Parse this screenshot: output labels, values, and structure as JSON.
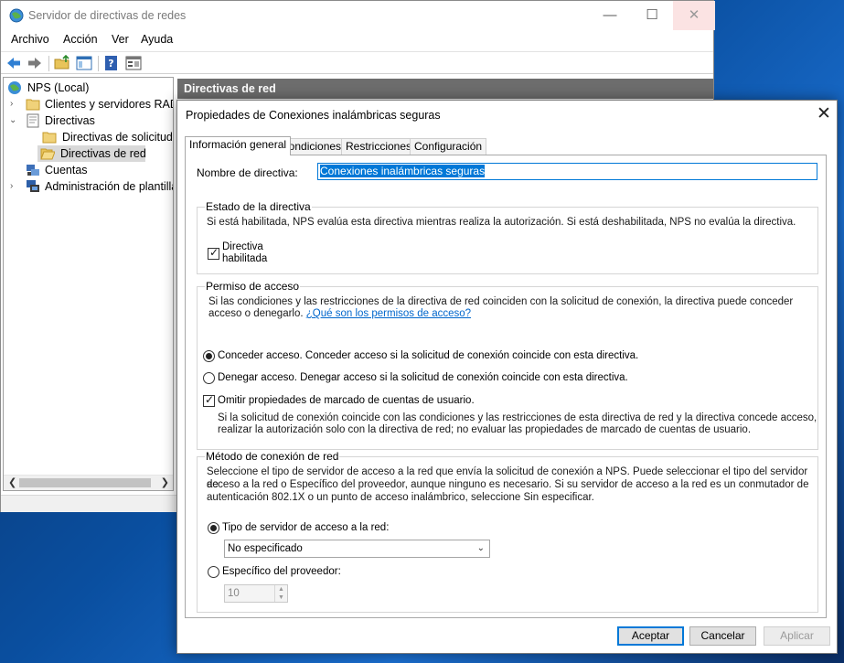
{
  "main_window": {
    "title": "Servidor de directivas de redes",
    "controls": {
      "minimize": "—",
      "maximize": "☐",
      "close": "✕"
    },
    "menu": [
      "Archivo",
      "Acción",
      "Ver",
      "Ayuda"
    ],
    "toolbar_icons": [
      "back-arrow-icon",
      "forward-arrow-icon",
      "folder-up-icon",
      "show-hide-tree-icon",
      "help-icon",
      "properties-icon"
    ]
  },
  "tree": {
    "items": [
      {
        "label": "NPS (Local)",
        "icon": "nps-globe-icon"
      },
      {
        "label": "Clientes y servidores RADIUS",
        "icon": "folder-icon"
      },
      {
        "label": "Directivas",
        "icon": "policies-icon"
      },
      {
        "label": "Directivas de solicitud de conexión",
        "icon": "folder-icon"
      },
      {
        "label": "Directivas de red",
        "icon": "folder-open-icon"
      },
      {
        "label": "Cuentas",
        "icon": "accounting-icon"
      },
      {
        "label": "Administración de plantillas",
        "icon": "templates-icon"
      }
    ]
  },
  "right_pane": {
    "header": "Directivas de red"
  },
  "dialog": {
    "title": "Propiedades de Conexiones inalámbricas seguras",
    "close": "✕",
    "tabs": [
      "Información general",
      "Condiciones",
      "Restricciones",
      "Configuración"
    ],
    "policy_name_label": "Nombre de directiva:",
    "policy_name_value": "Conexiones inalámbricas seguras",
    "estado": {
      "title": "Estado de la directiva",
      "description": "Si está habilitada, NPS evalúa esta directiva mientras realiza la autorización. Si está deshabilitada, NPS no evalúa la directiva.",
      "checkbox_line1": "Directiva",
      "checkbox_line2": "habilitada",
      "enabled": true
    },
    "permiso": {
      "title": "Permiso de acceso",
      "desc_line1": "Si las condiciones y las restricciones de la directiva de red coinciden con la solicitud de conexión, la directiva puede conceder",
      "desc_line2": "acceso o denegarlo.",
      "link": "¿Qué son los permisos de acceso?",
      "grant_label": "Conceder acceso. Conceder acceso si la solicitud de conexión coincide con esta directiva.",
      "deny_label": "Denegar acceso. Denegar acceso si la solicitud de conexión coincide con esta directiva.",
      "ignore_label": "Omitir propiedades de marcado de cuentas de usuario.",
      "ignore_desc_line1": "Si la solicitud de conexión coincide con las condiciones y las restricciones de esta directiva de red y la directiva concede acceso,",
      "ignore_desc_line2": "realizar la autorización solo con la directiva de red; no evaluar las propiedades de marcado de cuentas de usuario.",
      "selected": "grant",
      "ignore_checked": true
    },
    "metodo": {
      "title": "Método de conexión de red",
      "desc_line1": "Seleccione el tipo de servidor de acceso a la red que envía la solicitud de conexión a NPS. Puede seleccionar el tipo del servidor de",
      "desc_line2": "acceso a la red o Específico del proveedor, aunque ninguno es necesario. Si su servidor de acceso a la red es un conmutador de",
      "desc_line3": "autenticación 802.1X o un punto de acceso inalámbrico, seleccione Sin especificar.",
      "type_label": "Tipo de servidor de acceso a la red:",
      "type_value": "No especificado",
      "vendor_label": "Específico del proveedor:",
      "vendor_value": "10",
      "selected": "type"
    },
    "buttons": {
      "ok": "Aceptar",
      "cancel": "Cancelar",
      "apply": "Aplicar"
    }
  }
}
